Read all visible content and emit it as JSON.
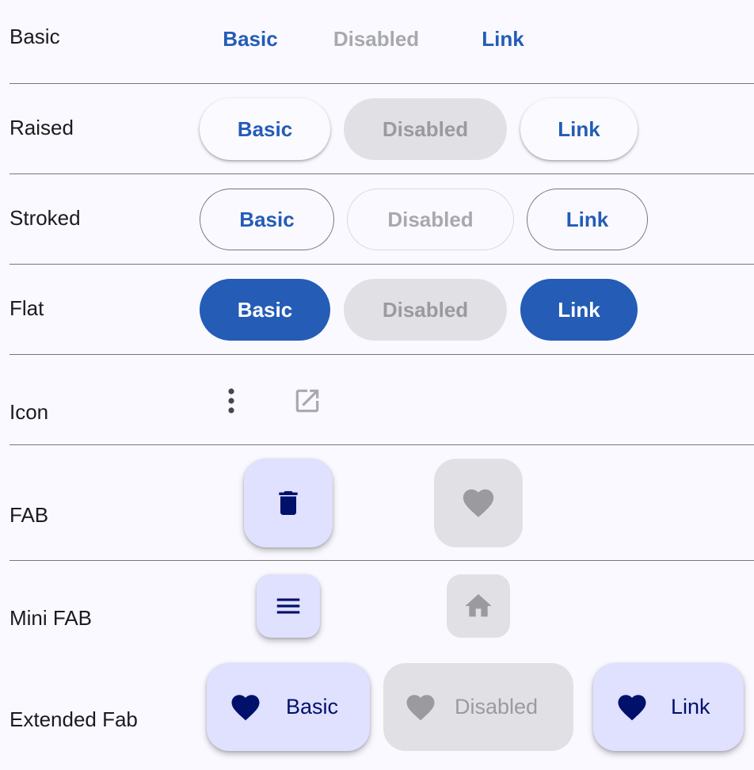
{
  "colors": {
    "primary": "#245cb6",
    "fab_container": "#e0e0ff",
    "fab_icon": "#00106b",
    "disabled_bg": "#e1e1e5",
    "disabled_text": "#9a9a9f"
  },
  "rows": {
    "basic": {
      "label": "Basic",
      "buttons": [
        "Basic",
        "Disabled",
        "Link"
      ]
    },
    "raised": {
      "label": "Raised",
      "buttons": [
        "Basic",
        "Disabled",
        "Link"
      ]
    },
    "stroked": {
      "label": "Stroked",
      "buttons": [
        "Basic",
        "Disabled",
        "Link"
      ]
    },
    "flat": {
      "label": "Flat",
      "buttons": [
        "Basic",
        "Disabled",
        "Link"
      ]
    },
    "icon": {
      "label": "Icon",
      "icons": [
        "more-vert-icon",
        "open-in-new-icon"
      ]
    },
    "fab": {
      "label": "FAB",
      "icons": [
        "delete-icon",
        "favorite-icon"
      ]
    },
    "mini_fab": {
      "label": "Mini FAB",
      "icons": [
        "menu-icon",
        "home-icon"
      ]
    },
    "extended_fab": {
      "label": "Extended Fab",
      "buttons": [
        "Basic",
        "Disabled",
        "Link"
      ],
      "icon": "favorite-icon"
    }
  }
}
